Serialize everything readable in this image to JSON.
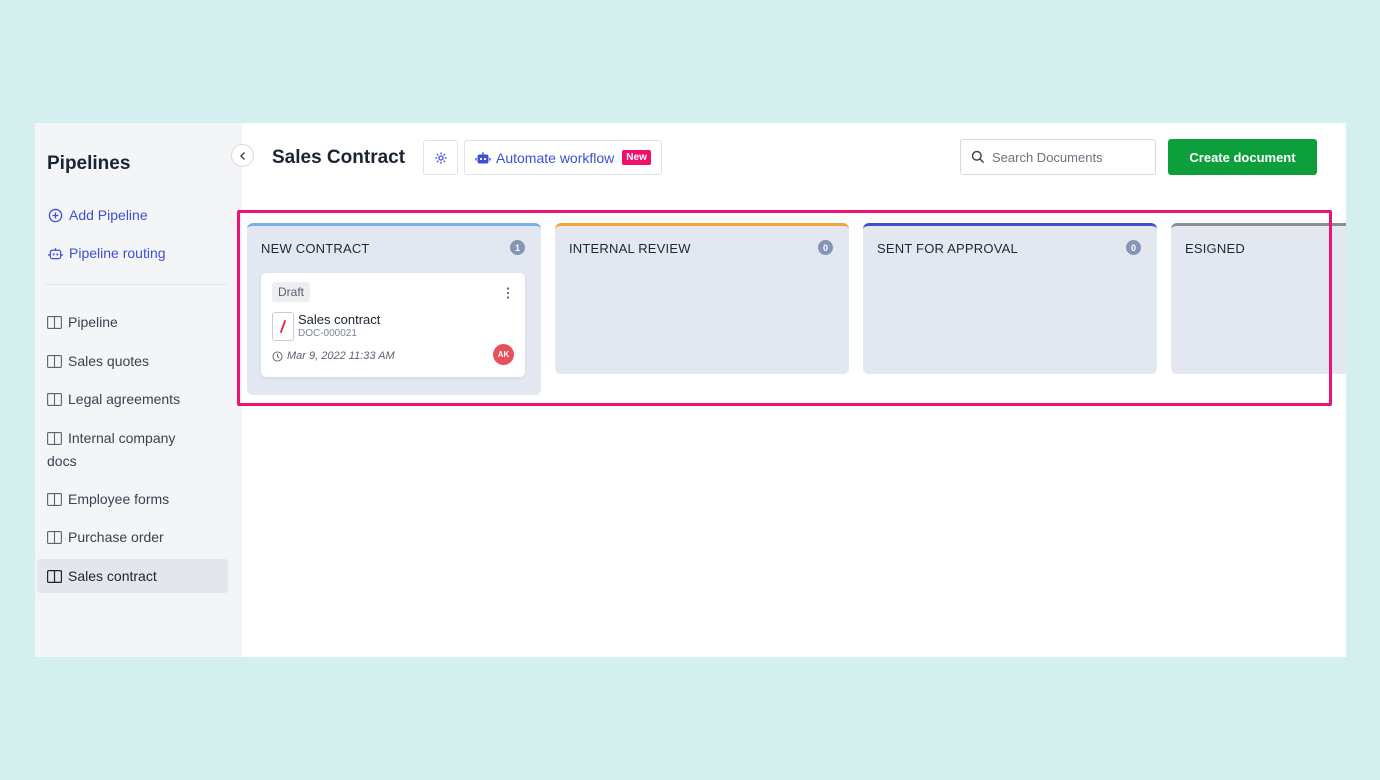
{
  "sidebar": {
    "title": "Pipelines",
    "actions": [
      {
        "label": "Add Pipeline",
        "icon": "plus-circle-icon"
      },
      {
        "label": "Pipeline routing",
        "icon": "robot-icon"
      }
    ],
    "items": [
      {
        "label": "Pipeline"
      },
      {
        "label": "Sales quotes"
      },
      {
        "label": "Legal agreements"
      },
      {
        "label": "Internal company docs"
      },
      {
        "label": "Employee forms"
      },
      {
        "label": "Purchase order"
      },
      {
        "label": "Sales contract",
        "active": true
      }
    ]
  },
  "header": {
    "title": "Sales Contract",
    "automate_label": "Automate workflow",
    "new_badge": "New",
    "search_placeholder": "Search Documents",
    "create_label": "Create document"
  },
  "columns": [
    {
      "title": "NEW CONTRACT",
      "count": "1",
      "accent": "#7aaee8",
      "card": {
        "status": "Draft",
        "title": "Sales contract",
        "id": "DOC-000021",
        "date": "Mar 9, 2022 11:33 AM",
        "avatar": "AK"
      }
    },
    {
      "title": "INTERNAL REVIEW",
      "count": "0",
      "accent": "#f0a73a"
    },
    {
      "title": "SENT FOR APPROVAL",
      "count": "0",
      "accent": "#3f4fcf"
    },
    {
      "title": "ESIGNED",
      "count": "",
      "accent": "#8a8d93"
    }
  ],
  "colors": {
    "background": "#d3f0ef",
    "accent_blue": "#3d4fd6",
    "create_green": "#0d9f3c",
    "highlight_pink": "#eb1474",
    "badge_pink": "#f0106b",
    "avatar_red": "#e8505b"
  }
}
